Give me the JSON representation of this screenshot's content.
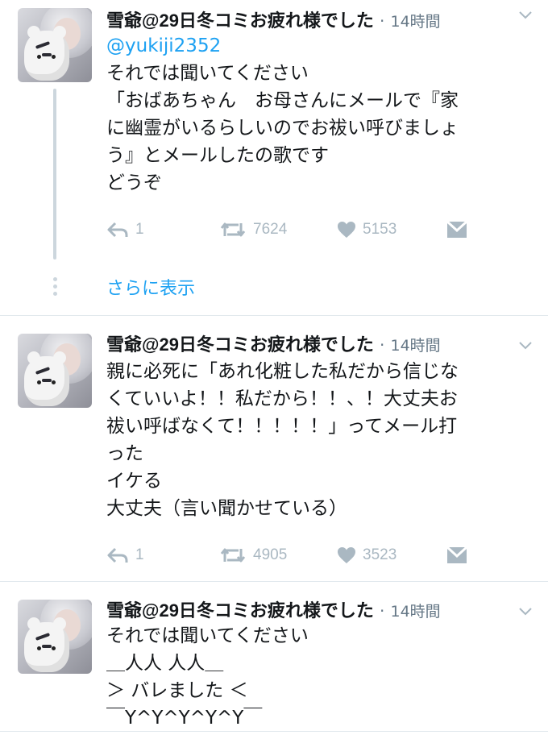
{
  "tweets": [
    {
      "name": "雪爺@29日冬コミお疲れ様でした",
      "time": "14時間",
      "mention": "@yukiji2352",
      "lines": [
        "それでは聞いてください",
        "「おばあちゃん　お母さんにメールで『家",
        "に幽霊がいるらしいのでお祓い呼びましょ",
        "う』とメールしたの歌です",
        "どうぞ"
      ],
      "reply_count": "1",
      "retweet_count": "7624",
      "like_count": "5153",
      "show_more": "さらに表示"
    },
    {
      "name": "雪爺@29日冬コミお疲れ様でした",
      "time": "14時間",
      "lines": [
        "親に必死に「あれ化粧した私だから信じな",
        "くていいよ！！私だから！！、！大丈夫お",
        "祓い呼ばなくて！！！！！」ってメール打",
        "った",
        "イケる",
        "大丈夫（言い聞かせている）"
      ],
      "reply_count": "1",
      "retweet_count": "4905",
      "like_count": "3523"
    },
    {
      "name": "雪爺@29日冬コミお疲れ様でした",
      "time": "14時間",
      "lines": [
        "それでは聞いてください",
        "＿人人 人人＿",
        "＞ バレました ＜",
        "￣Y^Y^Y^Y^Y￣"
      ]
    }
  ],
  "separator": "·",
  "icons": {
    "reply": "reply-icon",
    "retweet": "retweet-icon",
    "like": "heart-icon",
    "dm": "message-icon",
    "caret": "chevron-down-icon"
  },
  "colors": {
    "link": "#1da1f2",
    "muted": "#aab8c2",
    "meta": "#657786",
    "text": "#14171a",
    "thread": "#ccd6dd"
  }
}
